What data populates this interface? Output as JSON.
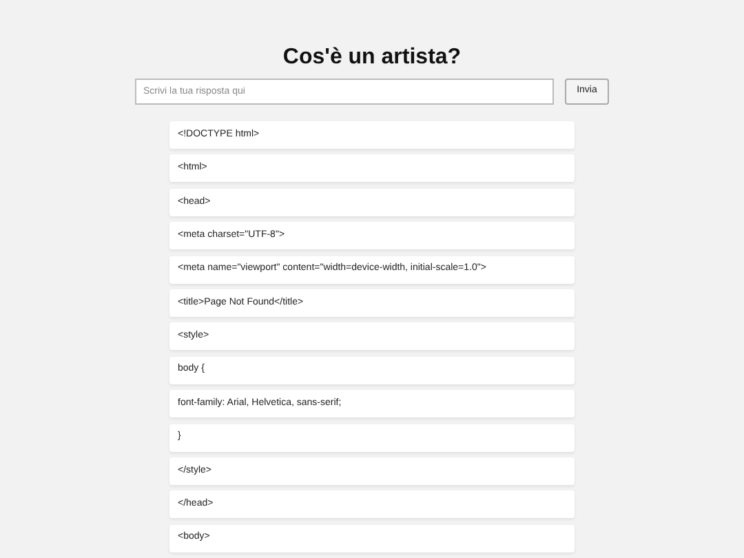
{
  "title": "Cos'è un artista?",
  "answer": {
    "placeholder": "Scrivi la tua risposta qui"
  },
  "submit": "Invia",
  "lines": [
    "<!DOCTYPE html>",
    "<html>",
    "<head>",
    "<meta charset=\"UTF-8\">",
    "<meta name=\"viewport\" content=\"width=device-width, initial-scale=1.0\">",
    "<title>Page Not Found</title>",
    "<style>",
    "body {",
    "font-family: Arial, Helvetica, sans-serif;",
    "}",
    "</style>",
    "</head>",
    "<body>"
  ]
}
